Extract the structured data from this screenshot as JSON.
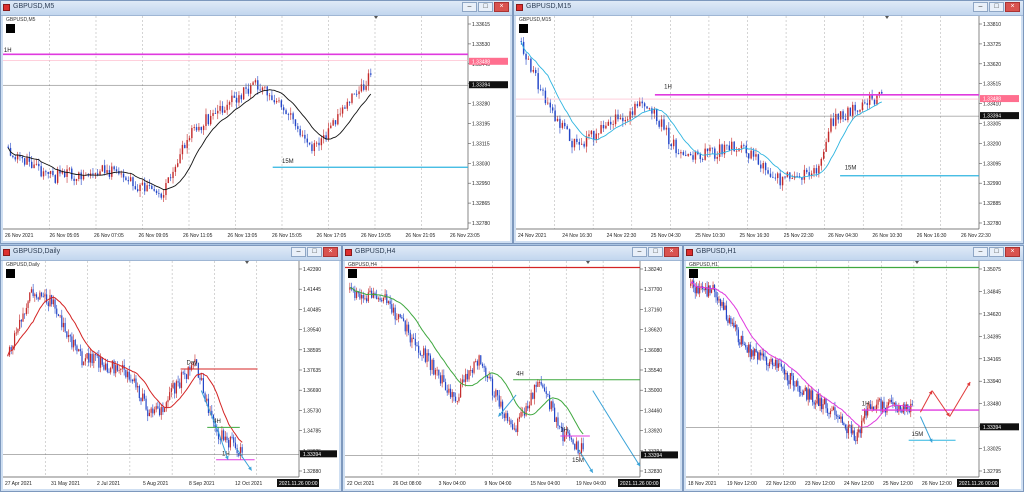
{
  "windows": [
    {
      "title": "GBPUSD,M5",
      "symbol": "GBPUSD,M5",
      "price_labels": [
        "1.33615",
        "1.33530",
        "1.33445",
        "1.33365",
        "1.33280",
        "1.33195",
        "1.33115",
        "1.33030",
        "1.32950",
        "1.32865",
        "1.32780"
      ],
      "price_badges": {
        "red": "1.33488",
        "dark": "1.33394"
      },
      "time_labels": [
        "26 Nov 2021",
        "26 Nov 05:05",
        "26 Nov 07:05",
        "26 Nov 09:05",
        "26 Nov 11:05",
        "26 Nov 13:05",
        "26 Nov 15:05",
        "26 Nov 17:05",
        "26 Nov 19:05",
        "26 Nov 21:05",
        "26 Nov 23:05"
      ],
      "annotations": [
        "1H",
        "15M"
      ]
    },
    {
      "title": "GBPUSD,M15",
      "symbol": "GBPUSD,M15",
      "price_labels": [
        "1.33810",
        "1.33725",
        "1.33620",
        "1.33515",
        "1.33410",
        "1.33305",
        "1.33200",
        "1.33095",
        "1.32990",
        "1.32885",
        "1.32780"
      ],
      "price_badges": {
        "red": "1.33488",
        "dark": "1.33394"
      },
      "time_labels": [
        "24 Nov 2021",
        "24 Nov 16:30",
        "24 Nov 22:30",
        "25 Nov 04:30",
        "25 Nov 10:30",
        "25 Nov 16:30",
        "25 Nov 22:30",
        "26 Nov 04:30",
        "26 Nov 10:30",
        "26 Nov 16:30",
        "26 Nov 22:30"
      ],
      "annotations": [
        "1H",
        "15M"
      ]
    },
    {
      "title": "GBPUSD,Daily",
      "symbol": "GBPUSD,Daily",
      "price_labels": [
        "1.42390",
        "1.41445",
        "1.40485",
        "1.39540",
        "1.38595",
        "1.37635",
        "1.36690",
        "1.35730",
        "1.34785",
        "1.33825",
        "1.32880"
      ],
      "price_badges": {
        "dark": "1.33394"
      },
      "time_labels": [
        "27 Apr 2021",
        "31 May 2021",
        "2 Jul 2021",
        "5 Aug 2021",
        "8 Sep 2021",
        "12 Oct 2021",
        "2021.11.26 00:00"
      ],
      "annotations": [
        "Day",
        "4H",
        "1H"
      ]
    },
    {
      "title": "GBPUSD,H4",
      "symbol": "GBPUSD,H4",
      "price_labels": [
        "1.38240",
        "1.37700",
        "1.37160",
        "1.36620",
        "1.36080",
        "1.35540",
        "1.35000",
        "1.34460",
        "1.33920",
        "1.33394",
        "1.32830"
      ],
      "price_badges": {
        "dark": "1.33394"
      },
      "time_labels": [
        "22 Oct 2021",
        "26 Oct 08:00",
        "3 Nov 04:00",
        "9 Nov 04:00",
        "15 Nov 04:00",
        "19 Nov 04:00",
        "2021.11.26 00:00"
      ],
      "annotations": [
        "4H",
        "1H",
        "15M"
      ]
    },
    {
      "title": "GBPUSD,H1",
      "symbol": "GBPUSD,H1",
      "price_labels": [
        "1.35075",
        "1.34845",
        "1.34620",
        "1.34395",
        "1.34165",
        "1.33940",
        "1.33480",
        "1.33255",
        "1.33025",
        "1.32795"
      ],
      "price_badges": {
        "dark": "1.33394"
      },
      "time_labels": [
        "18 Nov 2021",
        "19 Nov 12:00",
        "22 Nov 12:00",
        "23 Nov 12:00",
        "24 Nov 12:00",
        "25 Nov 12:00",
        "26 Nov 12:00",
        "2021.11.26 00:00"
      ],
      "annotations": [
        "1H",
        "15M"
      ]
    }
  ],
  "colors": {
    "up": "#c42a2a",
    "down": "#2346c8",
    "magenta": "#e03adf",
    "cyan": "#2fb5e0",
    "ma_red": "#d42424",
    "ma_green": "#3fa83f",
    "arrow_red": "#e03a3a",
    "arrow_blue": "#3aa3d8"
  },
  "window_controls": [
    "minimize",
    "maximize",
    "close"
  ]
}
